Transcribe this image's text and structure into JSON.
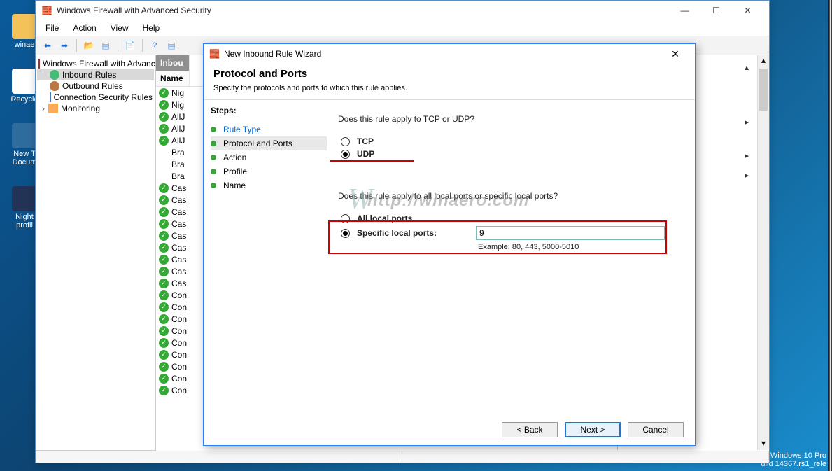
{
  "desktop": {
    "icons": [
      {
        "label": "winae"
      },
      {
        "label": "Recycle"
      },
      {
        "label": "New T\nDocum"
      },
      {
        "label": "Night\nprofil"
      }
    ],
    "sysinfo_line1": "Windows 10 Pro",
    "sysinfo_line2": "uild 14367.rs1_rele"
  },
  "mainWindow": {
    "title": "Windows Firewall with Advanced Security",
    "menu": {
      "file": "File",
      "action": "Action",
      "view": "View",
      "help": "Help"
    },
    "tree": {
      "root": "Windows Firewall with Advance",
      "items": [
        "Inbound Rules",
        "Outbound Rules",
        "Connection Security Rules",
        "Monitoring"
      ]
    },
    "list": {
      "header": "Inbou",
      "nameCol": "Name",
      "rows": [
        "Nig",
        "Nig",
        "AllJ",
        "AllJ",
        "AllJ",
        "Bra",
        "Bra",
        "Bra",
        "Cas",
        "Cas",
        "Cas",
        "Cas",
        "Cas",
        "Cas",
        "Cas",
        "Cas",
        "Cas",
        "Con",
        "Con",
        "Con",
        "Con",
        "Con",
        "Con",
        "Con",
        "Con",
        "Con"
      ]
    },
    "actionsPane": {
      "arrows": [
        "▲",
        "►",
        "►",
        "►"
      ]
    }
  },
  "wizard": {
    "title": "New Inbound Rule Wizard",
    "heading": "Protocol and Ports",
    "subheading": "Specify the protocols and ports to which this rule applies.",
    "stepsLabel": "Steps:",
    "steps": [
      {
        "label": "Rule Type",
        "link": true
      },
      {
        "label": "Protocol and Ports",
        "active": true
      },
      {
        "label": "Action"
      },
      {
        "label": "Profile"
      },
      {
        "label": "Name"
      }
    ],
    "q1": "Does this rule apply to TCP or UDP?",
    "tcp": "TCP",
    "udp": "UDP",
    "q2": "Does this rule apply to all local ports or specific local ports?",
    "allPorts": "All local ports",
    "specificPorts": "Specific local ports:",
    "portValue": "9",
    "example": "Example: 80, 443, 5000-5010",
    "watermark": "http://winaero.com",
    "buttons": {
      "back": "< Back",
      "next": "Next >",
      "cancel": "Cancel"
    }
  }
}
